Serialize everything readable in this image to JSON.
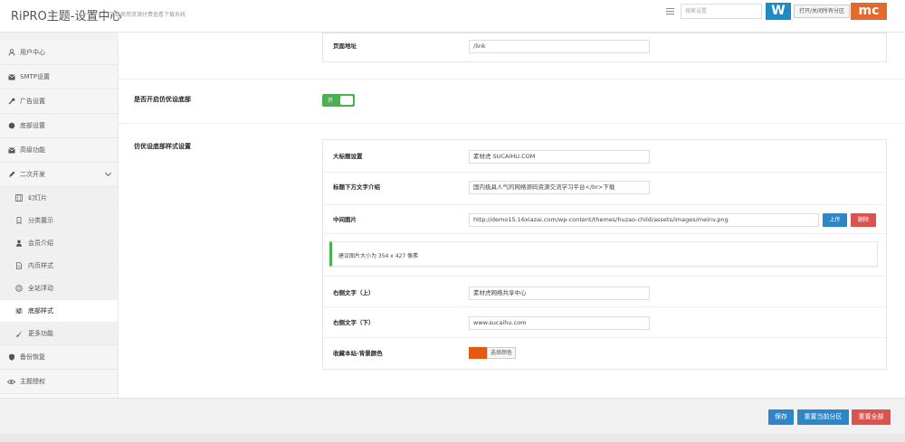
{
  "header": {
    "title": "RiPRO主题-设置中心",
    "subtitle": "顶级商用资源付费查看下载系统",
    "search_placeholder": "搜索设置",
    "expand_all_label": "打开/关闭所有分区",
    "watermark_left": "W",
    "watermark_right": "mc"
  },
  "sidebar": {
    "items": [
      {
        "label": "用户中心",
        "icon": "user-icon"
      },
      {
        "label": "SMTP设置",
        "icon": "mail-icon"
      },
      {
        "label": "广告设置",
        "icon": "wrench-icon"
      },
      {
        "label": "底部设置",
        "icon": "circle-icon"
      },
      {
        "label": "高级功能",
        "icon": "mail-icon"
      },
      {
        "label": "二次开发",
        "icon": "edit-icon"
      }
    ],
    "subitems": [
      {
        "label": "幻灯片",
        "icon": "film-icon"
      },
      {
        "label": "分类置示",
        "icon": "bookmark-icon"
      },
      {
        "label": "会员介绍",
        "icon": "user-icon"
      },
      {
        "label": "内页样式",
        "icon": "file-icon"
      },
      {
        "label": "全站浮动",
        "icon": "circle-icon"
      },
      {
        "label": "底部样式",
        "icon": "sliders-icon"
      },
      {
        "label": "更多功能",
        "icon": "brush-icon"
      }
    ],
    "bottom_items": [
      {
        "label": "备份恢复",
        "icon": "shield-icon"
      },
      {
        "label": "主题授权",
        "icon": "eye-icon"
      }
    ]
  },
  "main": {
    "page_url": {
      "label": "页面地址",
      "value": "/link"
    },
    "toggle": {
      "label": "是否开启仿优设底部",
      "state": "开"
    },
    "style_section": {
      "label": "仿优设底部样式设置",
      "fields": {
        "big_title": {
          "label": "大标题设置",
          "value": "素材虎 SUCAIHU.COM"
        },
        "title_desc": {
          "label": "标题下方文字介绍",
          "value": "国内极具人气的网络源码资源交流学习平台</br>下载"
        },
        "middle_image": {
          "label": "中间图片",
          "value": "http://demo15.16xiazai.com/wp-content/themes/huzao-child/assets/images/meinv.png",
          "upload_label": "上传",
          "remove_label": "删除"
        },
        "notice": "建议图片大小为 354 x 427 像素",
        "right_top": {
          "label": "右侧文字（上）",
          "value": "素材虎网络共享中心"
        },
        "right_bottom": {
          "label": "右侧文字（下）",
          "value": "www.sucaihu.com"
        },
        "bg_color": {
          "label": "收藏本站-背景颜色",
          "color": "#e4590f",
          "button_label": "选择颜色"
        }
      }
    }
  },
  "footer": {
    "save_label": "保存",
    "reset_section_label": "重置当前分区",
    "reset_all_label": "重置全部"
  }
}
